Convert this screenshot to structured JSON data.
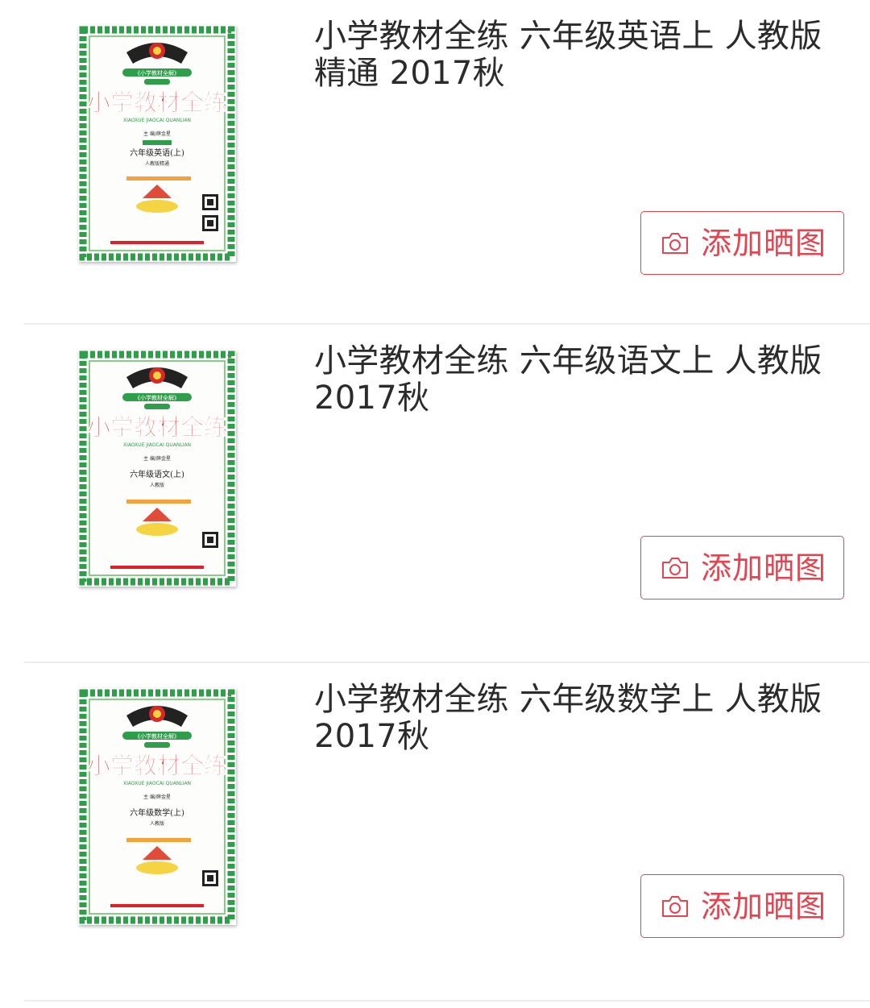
{
  "accent_color": "#e34550",
  "title_color": "#2b2b2b",
  "products": [
    {
      "title": "小学教材全练 六年级英语上 人教版精通 2017秋",
      "add_photo_label": "添加晒图",
      "cover": {
        "series_tag": "《小学教材全解》",
        "brand": "小学教材全练",
        "pinyin": "XIAOXUE JIAOCAI QUANLIAN",
        "editor": "主 编/薛金星",
        "grade_subject": "六年级英语(上)",
        "edition": "人教版精通"
      }
    },
    {
      "title": "小学教材全练 六年级语文上 人教版2017秋",
      "add_photo_label": "添加晒图",
      "cover": {
        "series_tag": "《小学教材全解》",
        "brand": "小学教材全练",
        "pinyin": "XIAOXUE JIAOCAI QUANLIAN",
        "editor": "主 编/薛金星",
        "grade_subject": "六年级语文(上)",
        "edition": "人教版"
      }
    },
    {
      "title": "小学教材全练 六年级数学上 人教版2017秋",
      "add_photo_label": "添加晒图",
      "cover": {
        "series_tag": "《小学教材全解》",
        "brand": "小学教材全练",
        "pinyin": "XIAOXUE JIAOCAI QUANLIAN",
        "editor": "主 编/薛金星",
        "grade_subject": "六年级数学(上)",
        "edition": "人教版"
      }
    }
  ],
  "icons": {
    "add_photo": "camera-icon"
  }
}
